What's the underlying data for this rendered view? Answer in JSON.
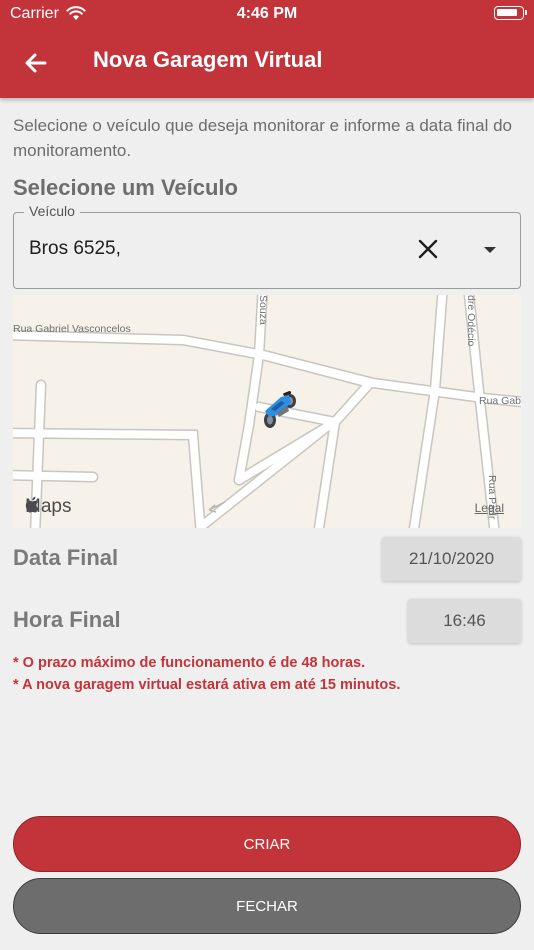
{
  "status_bar": {
    "carrier": "Carrier",
    "time": "4:46 PM",
    "battery_level": 0.85
  },
  "header": {
    "title": "Nova Garagem Virtual",
    "back_icon": "arrow-left-icon"
  },
  "intro_text": "Selecione o veículo que deseja monitorar e informe a data final do monitoramento.",
  "vehicle_section": {
    "title": "Selecione um Veículo",
    "field_label": "Veículo",
    "selected_value": "Bros 6525,",
    "clear_icon": "close-icon",
    "dropdown_icon": "caret-down-icon"
  },
  "map": {
    "logo_text": "Maps",
    "legal_text": "Legal",
    "streets": [
      "Rua Gabriel Vasconcelos",
      "Souza",
      "dre Odécio",
      "Rua Gab",
      "Rua Padr"
    ],
    "marker_icon": "motorcycle-icon"
  },
  "date_row": {
    "label": "Data Final",
    "value": "21/10/2020"
  },
  "time_row": {
    "label": "Hora Final",
    "value": "16:46"
  },
  "notes": [
    "* O prazo máximo de funcionamento é de 48 horas.",
    "* A nova garagem virtual estará ativa em até 15 minutos."
  ],
  "buttons": {
    "create": "CRIAR",
    "close": "FECHAR"
  },
  "colors": {
    "primary": "#c3343a",
    "secondary_button": "#6d6d6d",
    "background": "#efefef"
  }
}
